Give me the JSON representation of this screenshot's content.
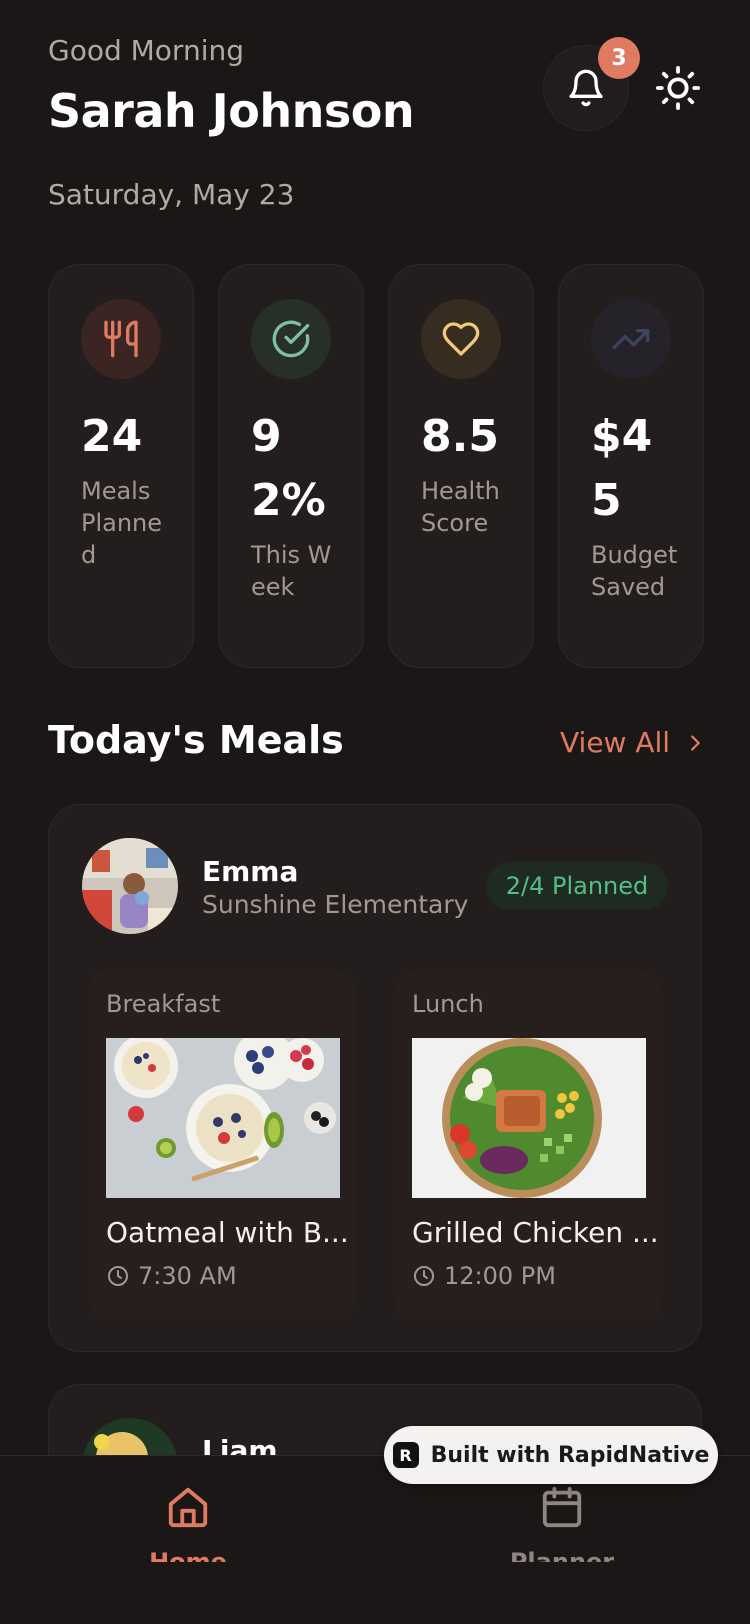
{
  "header": {
    "greeting": "Good Morning",
    "user_name": "Sarah Johnson",
    "date": "Saturday, May 23",
    "notification_count": "3"
  },
  "stats": [
    {
      "icon": "utensils-icon",
      "value": "24",
      "label": "Meals Planned",
      "color": "#e07b62"
    },
    {
      "icon": "check-circle-icon",
      "value": "92%",
      "label": "This Week",
      "color": "#7fbfa0"
    },
    {
      "icon": "heart-icon",
      "value": "8.5",
      "label": "Health Score",
      "color": "#f0c97a"
    },
    {
      "icon": "trending-up-icon",
      "value": "$45",
      "label": "Budget Saved",
      "color": "#3a3d55"
    }
  ],
  "section": {
    "title": "Today's Meals",
    "view_all": "View All"
  },
  "children": [
    {
      "name": "Emma",
      "school": "Sunshine Elementary",
      "planned": "2/4 Planned",
      "meals": [
        {
          "type": "Breakfast",
          "name": "Oatmeal with B...",
          "time": "7:30 AM"
        },
        {
          "type": "Lunch",
          "name": "Grilled Chicken ...",
          "time": "12:00 PM"
        }
      ]
    },
    {
      "name": "Liam"
    }
  ],
  "nav": {
    "home": "Home",
    "planner": "Planner"
  },
  "badge": {
    "text": "Built with RapidNative"
  },
  "colors": {
    "background": "#1b1716",
    "card": "#231e1d",
    "accent": "#e07b62",
    "success": "#53c083"
  }
}
